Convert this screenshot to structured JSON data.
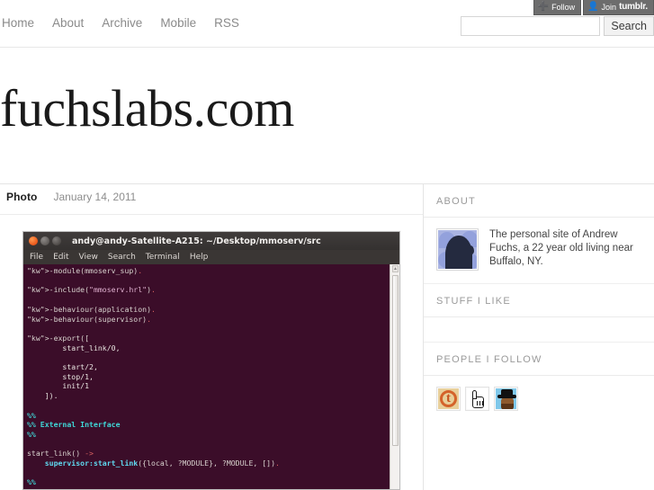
{
  "tumblr_bar": {
    "follow_label": "Follow",
    "follow_icon": "plus-icon",
    "join_prefix": "Join",
    "join_brand": "tumblr.",
    "join_icon": "person-icon"
  },
  "nav": {
    "items": [
      {
        "label": "Home"
      },
      {
        "label": "About"
      },
      {
        "label": "Archive"
      },
      {
        "label": "Mobile"
      },
      {
        "label": "RSS"
      }
    ]
  },
  "search": {
    "value": "",
    "placeholder": "",
    "button_label": "Search"
  },
  "site": {
    "title": "fuchslabs.com"
  },
  "post": {
    "type": "Photo",
    "date": "January 14, 2011",
    "terminal": {
      "window_title": "andy@andy-Satellite-A215: ~/Desktop/mmoserv/src",
      "menu": [
        "File",
        "Edit",
        "View",
        "Search",
        "Terminal",
        "Help"
      ],
      "buttons": [
        "close-button",
        "minimize-button",
        "maximize-button"
      ],
      "code_lines": [
        "-module(mmoserv_sup).",
        "",
        "-include(\"mmoserv.hrl\").",
        "",
        "-behaviour(application).",
        "-behaviour(supervisor).",
        "",
        "-export([",
        "        start_link/0,",
        "",
        "        start/2,",
        "        stop/1,",
        "        init/1",
        "    ]).",
        "",
        "%%",
        "%% External Interface",
        "%%",
        "",
        "start_link() ->",
        "    supervisor:start_link({local, ?MODULE}, ?MODULE, []).",
        "",
        "%%"
      ]
    }
  },
  "sidebar": {
    "sections": [
      {
        "heading": "ABOUT"
      },
      {
        "heading": "STUFF I LIKE"
      },
      {
        "heading": "PEOPLE I FOLLOW"
      }
    ],
    "about": {
      "heading": "ABOUT",
      "avatar": "head-silhouette-avatar",
      "text": "The personal site of Andrew Fuchs, a 22 year old living near Buffalo, NY."
    },
    "stuff_i_like": {
      "heading": "STUFF I LIKE",
      "items": []
    },
    "people_i_follow": {
      "heading": "PEOPLE I FOLLOW",
      "avatars": [
        {
          "name": "tumblr-logo-avatar"
        },
        {
          "name": "pointing-hand-avatar"
        },
        {
          "name": "black-hat-figure-avatar"
        }
      ]
    }
  },
  "colors": {
    "page_background": "#ffffff",
    "nav_link": "#8a8a8a",
    "title": "#1a1a1a",
    "rule": "#e6e6e6",
    "sidebar_heading": "#9a9a9a",
    "terminal_background": "#3b0d29",
    "terminal_chrome": "#3a3634",
    "tumblr_bar": "#6d6d6d"
  }
}
